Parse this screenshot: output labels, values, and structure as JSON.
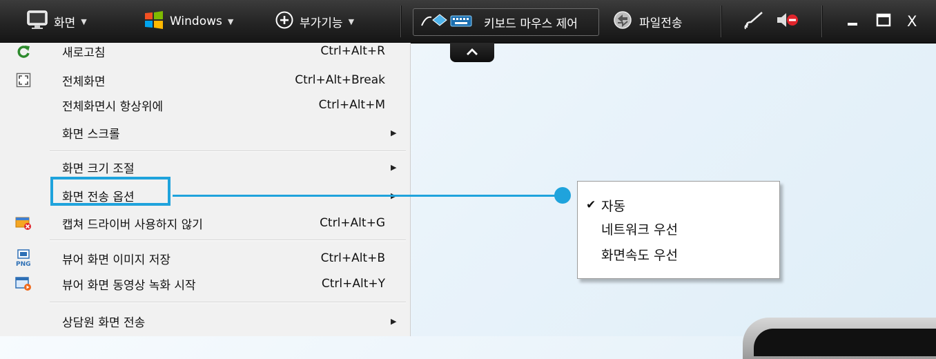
{
  "toolbar": {
    "screen_label": "화면",
    "windows_label": "Windows",
    "addon_label": "부가기능",
    "keyboard_mouse_label": "키보드 마우스 제어",
    "file_transfer_label": "파일전송",
    "window_controls": [
      "minimize-icon",
      "maximize-icon",
      "close-icon"
    ],
    "close_glyph": "X"
  },
  "menu": {
    "items": [
      {
        "label": "새로고침",
        "shortcut": "Ctrl+Alt+R",
        "icon": "refresh-icon"
      },
      {
        "label": "전체화면",
        "shortcut": "Ctrl+Alt+Break",
        "icon": "fullscreen-icon"
      },
      {
        "label": "전체화면시 항상위에",
        "shortcut": "Ctrl+Alt+M"
      },
      {
        "label": "화면 스크롤",
        "has_submenu": true
      },
      {
        "label": "화면 크기 조절",
        "has_submenu": true
      },
      {
        "label": "화면 전송 옵션",
        "has_submenu": true,
        "highlighted": true
      },
      {
        "label": "캡쳐 드라이버 사용하지 않기",
        "shortcut": "Ctrl+Alt+G",
        "icon": "capture-driver-icon"
      },
      {
        "label": "뷰어 화면 이미지 저장",
        "shortcut": "Ctrl+Alt+B",
        "icon": "png-save-icon"
      },
      {
        "label": "뷰어 화면 동영상 녹화 시작",
        "shortcut": "Ctrl+Alt+Y",
        "icon": "video-record-icon"
      },
      {
        "label": "상담원 화면 전송",
        "has_submenu": true
      }
    ]
  },
  "submenu": {
    "items": [
      {
        "label": "자동",
        "checked": true
      },
      {
        "label": "네트워크 우선",
        "checked": false
      },
      {
        "label": "화면속도 우선",
        "checked": false
      }
    ],
    "check_glyph": "✔"
  },
  "colors": {
    "highlight": "#1fa3dc",
    "toolbar_bg": "#242424",
    "menu_bg": "#f1f1f1"
  }
}
